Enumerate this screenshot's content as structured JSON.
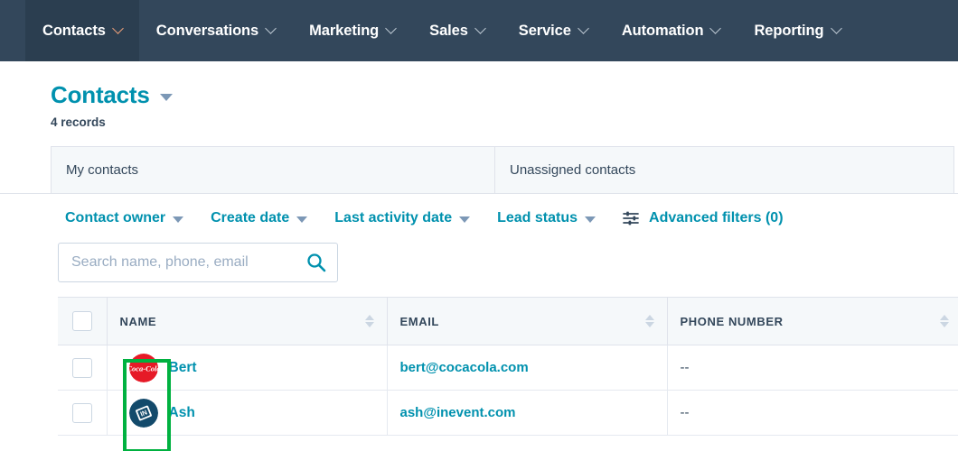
{
  "nav": {
    "items": [
      {
        "label": "Contacts",
        "active": true
      },
      {
        "label": "Conversations",
        "active": false
      },
      {
        "label": "Marketing",
        "active": false
      },
      {
        "label": "Sales",
        "active": false
      },
      {
        "label": "Service",
        "active": false
      },
      {
        "label": "Automation",
        "active": false
      },
      {
        "label": "Reporting",
        "active": false
      }
    ],
    "background_color": "#33475b",
    "active_background_color": "#2b3e50"
  },
  "header": {
    "title": "Contacts",
    "record_count": "4 records",
    "title_color": "#0091ae"
  },
  "tabs": [
    {
      "label": "My contacts"
    },
    {
      "label": "Unassigned contacts"
    }
  ],
  "filters": [
    {
      "label": "Contact owner",
      "has_caret": true
    },
    {
      "label": "Create date",
      "has_caret": true
    },
    {
      "label": "Last activity date",
      "has_caret": true
    },
    {
      "label": "Lead status",
      "has_caret": true
    },
    {
      "label": "Advanced filters (0)",
      "has_caret": false,
      "icon": "tune-icon"
    }
  ],
  "search": {
    "placeholder": "Search name, phone, email",
    "value": "",
    "icon": "search-icon"
  },
  "table": {
    "columns": [
      {
        "label": "NAME",
        "sortable": true
      },
      {
        "label": "EMAIL",
        "sortable": true
      },
      {
        "label": "PHONE NUMBER",
        "sortable": true
      }
    ],
    "rows": [
      {
        "name": "Bert",
        "email": "bert@cocacola.com",
        "phone": "--",
        "avatar": "coca-cola-logo"
      },
      {
        "name": "Ash",
        "email": "ash@inevent.com",
        "phone": "--",
        "avatar": "inevent-logo"
      }
    ]
  },
  "annotation": {
    "highlight_color": "#00b140",
    "target": "contact-avatars-column"
  }
}
